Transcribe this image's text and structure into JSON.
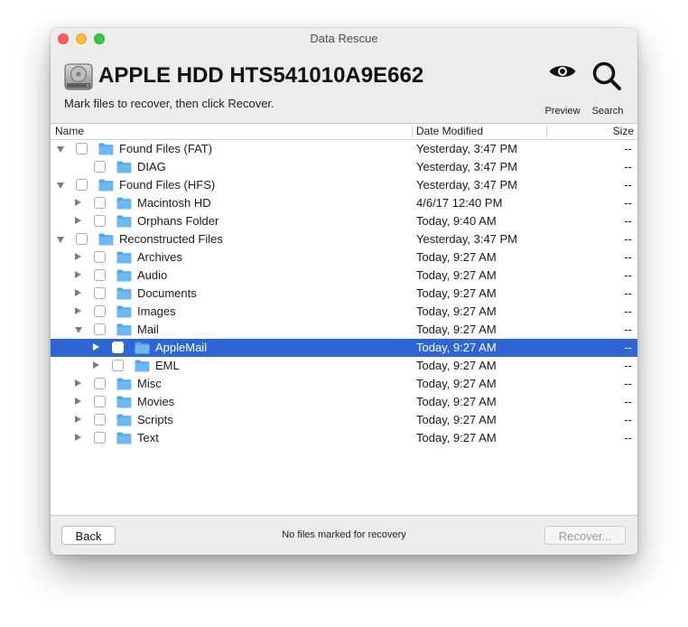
{
  "window": {
    "title": "Data Rescue"
  },
  "header": {
    "drive_name": "APPLE HDD HTS541010A9E662",
    "instruction": "Mark files to recover, then click Recover.",
    "preview_label": "Preview",
    "search_label": "Search"
  },
  "columns": {
    "name": "Name",
    "date": "Date Modified",
    "size": "Size"
  },
  "rows": [
    {
      "name": "Found Files (FAT)",
      "date": "Yesterday, 3:47 PM",
      "size": "--",
      "level": 0,
      "expander": "expanded",
      "checked": false,
      "selected": false
    },
    {
      "name": "DIAG",
      "date": "Yesterday, 3:47 PM",
      "size": "--",
      "level": 1,
      "expander": "none",
      "checked": false,
      "selected": false
    },
    {
      "name": "Found Files (HFS)",
      "date": "Yesterday, 3:47 PM",
      "size": "--",
      "level": 0,
      "expander": "expanded",
      "checked": false,
      "selected": false
    },
    {
      "name": "Macintosh HD",
      "date": "4/6/17 12:40 PM",
      "size": "--",
      "level": 1,
      "expander": "collapsed",
      "checked": false,
      "selected": false
    },
    {
      "name": "Orphans Folder",
      "date": "Today, 9:40 AM",
      "size": "--",
      "level": 1,
      "expander": "collapsed",
      "checked": false,
      "selected": false
    },
    {
      "name": "Reconstructed Files",
      "date": "Yesterday, 3:47 PM",
      "size": "--",
      "level": 0,
      "expander": "expanded",
      "checked": false,
      "selected": false
    },
    {
      "name": "Archives",
      "date": "Today, 9:27 AM",
      "size": "--",
      "level": 1,
      "expander": "collapsed",
      "checked": false,
      "selected": false
    },
    {
      "name": "Audio",
      "date": "Today, 9:27 AM",
      "size": "--",
      "level": 1,
      "expander": "collapsed",
      "checked": false,
      "selected": false
    },
    {
      "name": "Documents",
      "date": "Today, 9:27 AM",
      "size": "--",
      "level": 1,
      "expander": "collapsed",
      "checked": false,
      "selected": false
    },
    {
      "name": "Images",
      "date": "Today, 9:27 AM",
      "size": "--",
      "level": 1,
      "expander": "collapsed",
      "checked": false,
      "selected": false
    },
    {
      "name": "Mail",
      "date": "Today, 9:27 AM",
      "size": "--",
      "level": 1,
      "expander": "expanded",
      "checked": false,
      "selected": false
    },
    {
      "name": "AppleMail",
      "date": "Today, 9:27 AM",
      "size": "--",
      "level": 2,
      "expander": "collapsed",
      "checked": false,
      "selected": true
    },
    {
      "name": "EML",
      "date": "Today, 9:27 AM",
      "size": "--",
      "level": 2,
      "expander": "collapsed",
      "checked": false,
      "selected": false
    },
    {
      "name": "Misc",
      "date": "Today, 9:27 AM",
      "size": "--",
      "level": 1,
      "expander": "collapsed",
      "checked": false,
      "selected": false
    },
    {
      "name": "Movies",
      "date": "Today, 9:27 AM",
      "size": "--",
      "level": 1,
      "expander": "collapsed",
      "checked": false,
      "selected": false
    },
    {
      "name": "Scripts",
      "date": "Today, 9:27 AM",
      "size": "--",
      "level": 1,
      "expander": "collapsed",
      "checked": false,
      "selected": false
    },
    {
      "name": "Text",
      "date": "Today, 9:27 AM",
      "size": "--",
      "level": 1,
      "expander": "collapsed",
      "checked": false,
      "selected": false
    }
  ],
  "footer": {
    "back_label": "Back",
    "status": "No files marked for recovery",
    "recover_label": "Recover..."
  },
  "colors": {
    "selection": "#2f66d6",
    "folder": "#6cb8f2",
    "folder_tab": "#4fa6ea",
    "traffic_close": "#fc605b",
    "traffic_minimize": "#fdbc40",
    "traffic_zoom": "#34c84a"
  },
  "icons": {
    "drive": "hard-drive-icon",
    "preview": "eye-icon",
    "search": "magnifier-icon",
    "folder": "folder-icon",
    "disclosure": "disclosure-triangle-icon"
  }
}
